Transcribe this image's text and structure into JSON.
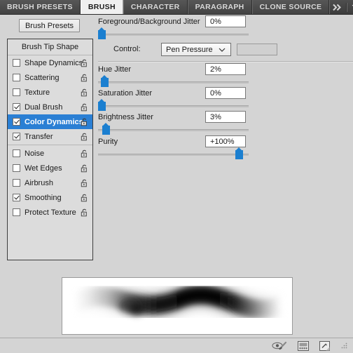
{
  "window": {
    "title": "Brush Panel"
  },
  "tabbar": {
    "tabs": [
      {
        "label": "BRUSH PRESETS",
        "active": false
      },
      {
        "label": "BRUSH",
        "active": true
      },
      {
        "label": "CHARACTER",
        "active": false
      },
      {
        "label": "PARAGRAPH",
        "active": false
      },
      {
        "label": "CLONE SOURCE",
        "active": false
      }
    ],
    "collapse_icon": "double-chevron-right-icon",
    "menu_icon": "panel-menu-icon"
  },
  "sidebar": {
    "presets_button": "Brush Presets",
    "header": "Brush Tip Shape",
    "items": [
      {
        "label": "Shape Dynamics",
        "checked": false,
        "selected": false,
        "lock": "unlocked-padlock-icon"
      },
      {
        "label": "Scattering",
        "checked": false,
        "selected": false,
        "lock": "unlocked-padlock-icon"
      },
      {
        "label": "Texture",
        "checked": false,
        "selected": false,
        "lock": "unlocked-padlock-icon"
      },
      {
        "label": "Dual Brush",
        "checked": true,
        "selected": false,
        "lock": "unlocked-padlock-icon"
      },
      {
        "label": "Color Dynamics",
        "checked": true,
        "selected": true,
        "lock": "unlocked-padlock-icon"
      },
      {
        "label": "Transfer",
        "checked": true,
        "selected": false,
        "lock": "unlocked-padlock-icon"
      }
    ],
    "items2": [
      {
        "label": "Noise",
        "checked": false,
        "selected": false,
        "lock": "unlocked-padlock-icon"
      },
      {
        "label": "Wet Edges",
        "checked": false,
        "selected": false,
        "lock": "unlocked-padlock-icon"
      },
      {
        "label": "Airbrush",
        "checked": false,
        "selected": false,
        "lock": "unlocked-padlock-icon"
      },
      {
        "label": "Smoothing",
        "checked": true,
        "selected": false,
        "lock": "unlocked-padlock-icon"
      },
      {
        "label": "Protect Texture",
        "checked": false,
        "selected": false,
        "lock": "unlocked-padlock-icon"
      }
    ]
  },
  "controls": {
    "fg_bg_jitter": {
      "label": "Foreground/Background Jitter",
      "value": "0%",
      "slider_percent": 0
    },
    "control": {
      "label": "Control:",
      "value": "Pen Pressure",
      "chevron": "chevron-down-icon",
      "aux_value": ""
    },
    "hue_jitter": {
      "label": "Hue Jitter",
      "value": "2%",
      "slider_percent": 2
    },
    "saturation_jitter": {
      "label": "Saturation Jitter",
      "value": "0%",
      "slider_percent": 0
    },
    "brightness_jitter": {
      "label": "Brightness Jitter",
      "value": "3%",
      "slider_percent": 3
    },
    "purity": {
      "label": "Purity",
      "value": "+100%",
      "slider_percent": 100
    }
  },
  "preview": {
    "name": "brush-stroke-preview",
    "description": "S-curve brush stroke, soft gray at ends, dense black at center"
  },
  "footer": {
    "icons": [
      {
        "name": "toggle-brush-preview-icon"
      },
      {
        "name": "brush-presets-panel-icon"
      },
      {
        "name": "new-brush-icon"
      }
    ],
    "resize_grip": "resize-grip-icon"
  },
  "colors": {
    "accent_blue": "#1b7fd0",
    "selection_blue": "#2a7fd4",
    "panel_bg": "#d4d4d4",
    "tabbar_dark": "#4a4a4a"
  }
}
